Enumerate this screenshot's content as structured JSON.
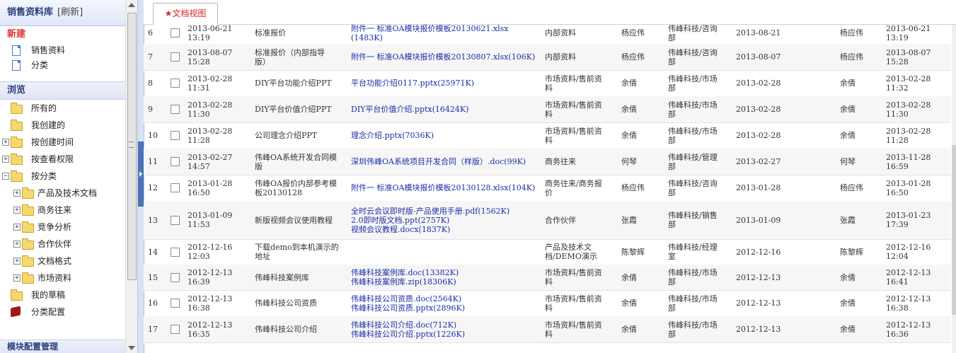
{
  "sidebar": {
    "title": "销售资料库",
    "refresh": "[刷新]",
    "new_section": "新建",
    "new_items": [
      "销售资料",
      "分类"
    ],
    "browse_section": "浏览",
    "browse_items": [
      "所有的",
      "我创建的",
      "按创建时间",
      "按查看权限",
      "按分类"
    ],
    "category_items": [
      "产品及技术文档",
      "商务往来",
      "竞争分析",
      "合作伙伴",
      "文档格式",
      "市场资料"
    ],
    "tail_items": [
      "我的草稿",
      "分类配置"
    ],
    "module_section": "模块配置管理"
  },
  "tabs": {
    "active": "★文档视图"
  },
  "rows": [
    {
      "no": "6",
      "created": [
        "2013-06-21",
        "13:19"
      ],
      "title": [
        "标准报价"
      ],
      "files": [
        "附件一 标准OA模块报价模板20130621.xlsx",
        "(1483K)"
      ],
      "category": [
        "内部资料"
      ],
      "author": "杨应伟",
      "dept": [
        "伟峰科技/咨询",
        "部"
      ],
      "date": "2013-08-21",
      "modifier": "杨应伟",
      "modified": [
        "2013-06-21",
        "13:19"
      ]
    },
    {
      "no": "7",
      "created": [
        "2013-08-07",
        "15:28"
      ],
      "title": [
        "标准报价（内部指导",
        "版）"
      ],
      "files": [
        "附件一 标准OA模块报价模板20130807.xlsx(106K)"
      ],
      "category": [
        "内部资料"
      ],
      "author": "杨应伟",
      "dept": [
        "伟峰科技/咨询",
        "部"
      ],
      "date": "2013-08-07",
      "modifier": "杨应伟",
      "modified": [
        "2013-08-07",
        "15:28"
      ]
    },
    {
      "no": "8",
      "created": [
        "2013-02-28",
        "11:31"
      ],
      "title": [
        "DIY平台功能介绍PPT"
      ],
      "files": [
        "平台功能介绍0117.pptx(25971K)"
      ],
      "category": [
        "市场资料/售前资",
        "料"
      ],
      "author": "余倩",
      "dept": [
        "伟峰科技/市场",
        "部"
      ],
      "date": "2013-02-28",
      "modifier": "余倩",
      "modified": [
        "2013-02-28",
        "11:32"
      ]
    },
    {
      "no": "9",
      "created": [
        "2013-02-28",
        "11:30"
      ],
      "title": [
        "DIY平台价值介绍PPT"
      ],
      "files": [
        "DIY平台价值介绍.pptx(16424K)"
      ],
      "category": [
        "市场资料/售前资",
        "料"
      ],
      "author": "余倩",
      "dept": [
        "伟峰科技/市场",
        "部"
      ],
      "date": "2013-02-28",
      "modifier": "余倩",
      "modified": [
        "2013-02-28",
        "11:30"
      ]
    },
    {
      "no": "10",
      "created": [
        "2013-02-28",
        "11:28"
      ],
      "title": [
        "公司理念介绍PPT"
      ],
      "files": [
        "理念介绍.pptx(7036K)"
      ],
      "category": [
        "市场资料/售前资",
        "料"
      ],
      "author": "余倩",
      "dept": [
        "伟峰科技/市场",
        "部"
      ],
      "date": "2013-02-28",
      "modifier": "余倩",
      "modified": [
        "2013-02-28",
        "11:28"
      ]
    },
    {
      "no": "11",
      "created": [
        "2013-02-27",
        "14:57"
      ],
      "title": [
        "伟峰OA系统开发合同模",
        "版"
      ],
      "files": [
        "深圳伟峰OA系统项目开发合同（样版）.doc(99K)"
      ],
      "category": [
        "商务往来"
      ],
      "author": "何琴",
      "dept": [
        "伟峰科技/管理",
        "部"
      ],
      "date": "2013-02-27",
      "modifier": "何琴",
      "modified": [
        "2013-11-28",
        "16:59"
      ]
    },
    {
      "no": "12",
      "created": [
        "2013-01-28",
        "16:50"
      ],
      "title": [
        "伟峰OA报价内部参考模",
        "板20130128"
      ],
      "files": [
        "附件一 标准OA模块报价模板20130128.xlsx(104K)"
      ],
      "category": [
        "商务往来/商务报",
        "价"
      ],
      "author": "杨应伟",
      "dept": [
        "伟峰科技/咨询",
        "部"
      ],
      "date": "2013-01-28",
      "modifier": "杨应伟",
      "modified": [
        "2013-01-28",
        "16:50"
      ]
    },
    {
      "no": "13",
      "created": [
        "2013-01-09",
        "11:53"
      ],
      "title": [
        "新版视频会议使用教程"
      ],
      "files": [
        "全时云会议即时版-产品使用手册.pdf(1562K)",
        "2.0即时版文档.ppt(2757K)",
        "视频会议教程.docx(1837K)"
      ],
      "category": [
        "合作伙伴"
      ],
      "author": "张霞",
      "dept": [
        "伟峰科技/销售",
        "部"
      ],
      "date": "2013-01-09",
      "modifier": "张霞",
      "modified": [
        "2013-01-23",
        "17:39"
      ]
    },
    {
      "no": "14",
      "created": [
        "2012-12-16",
        "12:03"
      ],
      "title": [
        "下载demo到本机演示的",
        "地址"
      ],
      "files": [],
      "category": [
        "产品及技术文",
        "档/DEMO演示"
      ],
      "author": "陈黎辉",
      "dept": [
        "伟峰科技/经理",
        "室"
      ],
      "date": "2012-12-16",
      "modifier": "陈黎辉",
      "modified": [
        "2012-12-16",
        "12:04"
      ]
    },
    {
      "no": "15",
      "created": [
        "2012-12-13",
        "16:39"
      ],
      "title": [
        "伟峰科技案例库"
      ],
      "files": [
        "伟峰科技案例库.doc(13382K)",
        "伟峰科技案例库.zip(18306K)"
      ],
      "category": [
        "市场资料/售前资",
        "料"
      ],
      "author": "余倩",
      "dept": [
        "伟峰科技/市场",
        "部"
      ],
      "date": "2012-12-13",
      "modifier": "余倩",
      "modified": [
        "2012-12-13",
        "16:41"
      ]
    },
    {
      "no": "16",
      "created": [
        "2012-12-13",
        "16:38"
      ],
      "title": [
        "伟峰科技公司资质"
      ],
      "files": [
        "伟峰科技公司资质.doc(2564K)",
        "伟峰科技公司资质.pptx(2896K)"
      ],
      "category": [
        "市场资料/售前资",
        "料"
      ],
      "author": "余倩",
      "dept": [
        "伟峰科技/市场",
        "部"
      ],
      "date": "2012-12-13",
      "modifier": "余倩",
      "modified": [
        "2012-12-13",
        "16:38"
      ]
    },
    {
      "no": "17",
      "created": [
        "2012-12-13",
        "16:35"
      ],
      "title": [
        "伟峰科技公司介绍"
      ],
      "files": [
        "伟峰科技公司介绍.doc(712K)",
        "伟峰科技公司介绍.pptx(1226K)"
      ],
      "category": [
        "市场资料/售前资",
        "料"
      ],
      "author": "余倩",
      "dept": [
        "伟峰科技/市场",
        "部"
      ],
      "date": "2012-12-13",
      "modifier": "余倩",
      "modified": [
        "2012-12-13",
        "16:36"
      ]
    }
  ]
}
